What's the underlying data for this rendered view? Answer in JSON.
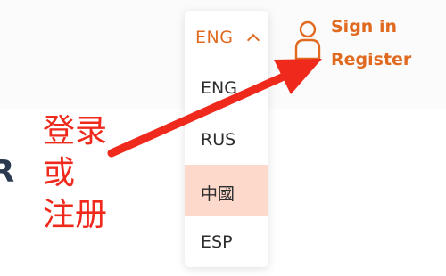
{
  "header": {
    "language": {
      "current": "ENG",
      "options": [
        "ENG",
        "RUS",
        "中國",
        "ESP"
      ],
      "highlighted": "中國"
    },
    "account": {
      "sign_in": "Sign in",
      "register": "Register"
    }
  },
  "page": {
    "partial_heading": "R"
  },
  "annotation": {
    "lines": [
      "登录",
      "或",
      "注册"
    ],
    "color": "#ef2a1d"
  },
  "colors": {
    "accent": "#e06a1f",
    "highlight": "#fcd9cb",
    "text": "#2d2d2d"
  }
}
